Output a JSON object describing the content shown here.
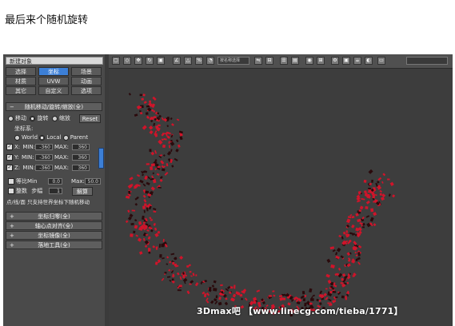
{
  "caption": "最后来个随机旋转",
  "panel": {
    "title": "新建对象",
    "tabs": [
      "选择",
      "坐标",
      "场景",
      "材质",
      "UVW",
      "动画",
      "其它",
      "自定义",
      "选项"
    ],
    "active_tab": "坐标",
    "section_title": "随机移动/旋转/缩放(全)",
    "mode_move": "移动",
    "mode_rotate": "旋转",
    "mode_scale": "缩放",
    "reset_label": "Reset",
    "coord_label": "坐标系:",
    "coord_world": "World",
    "coord_local": "Local",
    "coord_parent": "Parent",
    "axes": [
      {
        "axis": "X:",
        "min_label": "MIN:",
        "min": "-360",
        "max_label": "MAX:",
        "max": "360"
      },
      {
        "axis": "Y:",
        "min_label": "MIN:",
        "min": "-360",
        "max_label": "MAX:",
        "max": "360"
      },
      {
        "axis": "Z:",
        "min_label": "MIN:",
        "min": "-360",
        "max_label": "MAX:",
        "max": "360"
      }
    ],
    "uniform_label": "等比Min",
    "uniform_min": "0.0",
    "uniform_max_label": "Max:",
    "uniform_max": "50.0",
    "integer_label": "整数",
    "step_label": "步幅",
    "step_value": "1",
    "unlock_label": "解算",
    "note": "点/线/面 只支持世界坐标下随机移动",
    "rollups": [
      "坐标归零(全)",
      "轴心点对齐(全)",
      "坐标镜像(全)",
      "落地工具(全)"
    ]
  },
  "toolbar": {
    "select_filter": "按名称选择"
  },
  "watermark": "3Dmax吧 【www.linecg.com/tieba/1771】",
  "colors": {
    "panel_bg": "#4a4a4a",
    "viewport_bg": "#3d3d3d",
    "accent": "#3c7fd6",
    "particle_red": "#d0142a",
    "particle_dark": "#2a0a0c"
  }
}
